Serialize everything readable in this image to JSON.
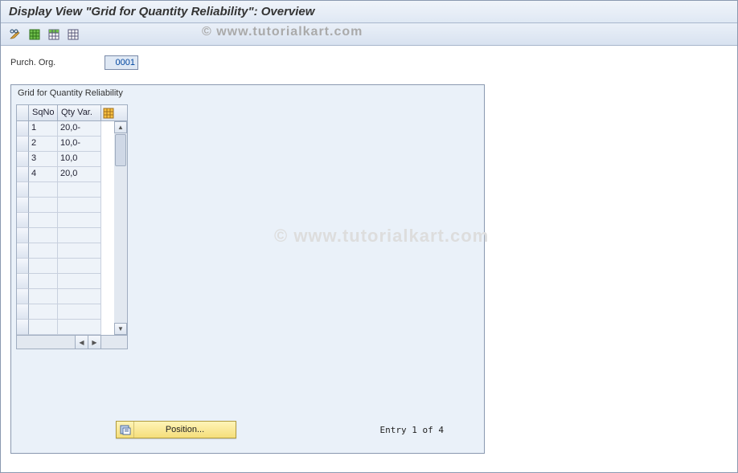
{
  "title": "Display View \"Grid for Quantity Reliability\": Overview",
  "watermark": "© www.tutorialkart.com",
  "form": {
    "purchOrg_label": "Purch. Org.",
    "purchOrg_value": "0001"
  },
  "panel": {
    "title": "Grid for Quantity Reliability",
    "columns": {
      "col1": "SqNo",
      "col2": "Qty Var."
    },
    "rows": [
      {
        "sqno": "1",
        "qtyvar": "20,0-"
      },
      {
        "sqno": "2",
        "qtyvar": "10,0-"
      },
      {
        "sqno": "3",
        "qtyvar": "10,0"
      },
      {
        "sqno": "4",
        "qtyvar": "20,0"
      }
    ],
    "emptyRows": 10
  },
  "positionButton": "Position...",
  "entryStatus": "Entry 1 of 4"
}
